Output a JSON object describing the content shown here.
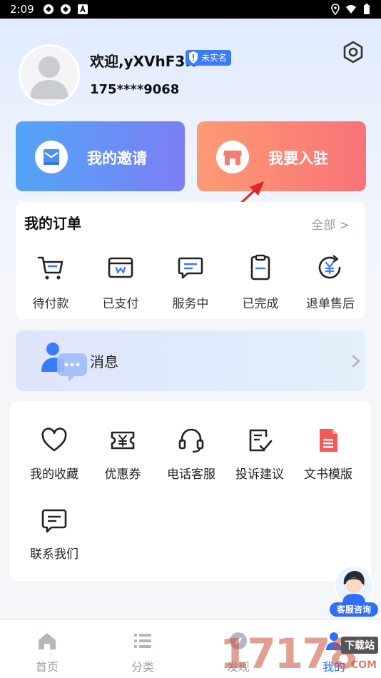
{
  "status_bar": {
    "time": "2:09"
  },
  "profile": {
    "username": "欢迎,yXVhF3N",
    "verify_badge": "未实名",
    "phone": "175****9068"
  },
  "cards": {
    "invite_label": "我的邀请",
    "join_label": "我要入驻"
  },
  "orders": {
    "title": "我的订单",
    "all_link": "全部 >",
    "items": [
      {
        "label": "待付款",
        "icon": "cart-icon"
      },
      {
        "label": "已支付",
        "icon": "wallet-icon"
      },
      {
        "label": "服务中",
        "icon": "chat-icon"
      },
      {
        "label": "已完成",
        "icon": "clipboard-icon"
      },
      {
        "label": "退单售后",
        "icon": "refund-icon"
      }
    ]
  },
  "messages": {
    "label": "消息"
  },
  "tools": [
    {
      "label": "我的收藏",
      "icon": "heart-icon"
    },
    {
      "label": "优惠券",
      "icon": "coupon-icon"
    },
    {
      "label": "电话客服",
      "icon": "headset-icon"
    },
    {
      "label": "投诉建议",
      "icon": "feedback-icon"
    },
    {
      "label": "文书模版",
      "icon": "document-icon"
    },
    {
      "label": "联系我们",
      "icon": "message-icon"
    }
  ],
  "floating_service": {
    "label": "客服咨询"
  },
  "bottom_nav": [
    {
      "label": "首页",
      "icon": "home-icon"
    },
    {
      "label": "分类",
      "icon": "list-icon"
    },
    {
      "label": "发现",
      "icon": "discover-icon"
    },
    {
      "label": "我的",
      "icon": "profile-icon",
      "active": true
    }
  ],
  "watermark": {
    "text": "17178",
    "tag": "下载站",
    "suffix": "COM"
  },
  "colors": {
    "accent": "#2f6ef8",
    "invite_gradient": [
      "#52a5f7",
      "#7b7ff4"
    ],
    "join_gradient": [
      "#fd9b73",
      "#fa7278"
    ],
    "arrow": "#e02424"
  }
}
